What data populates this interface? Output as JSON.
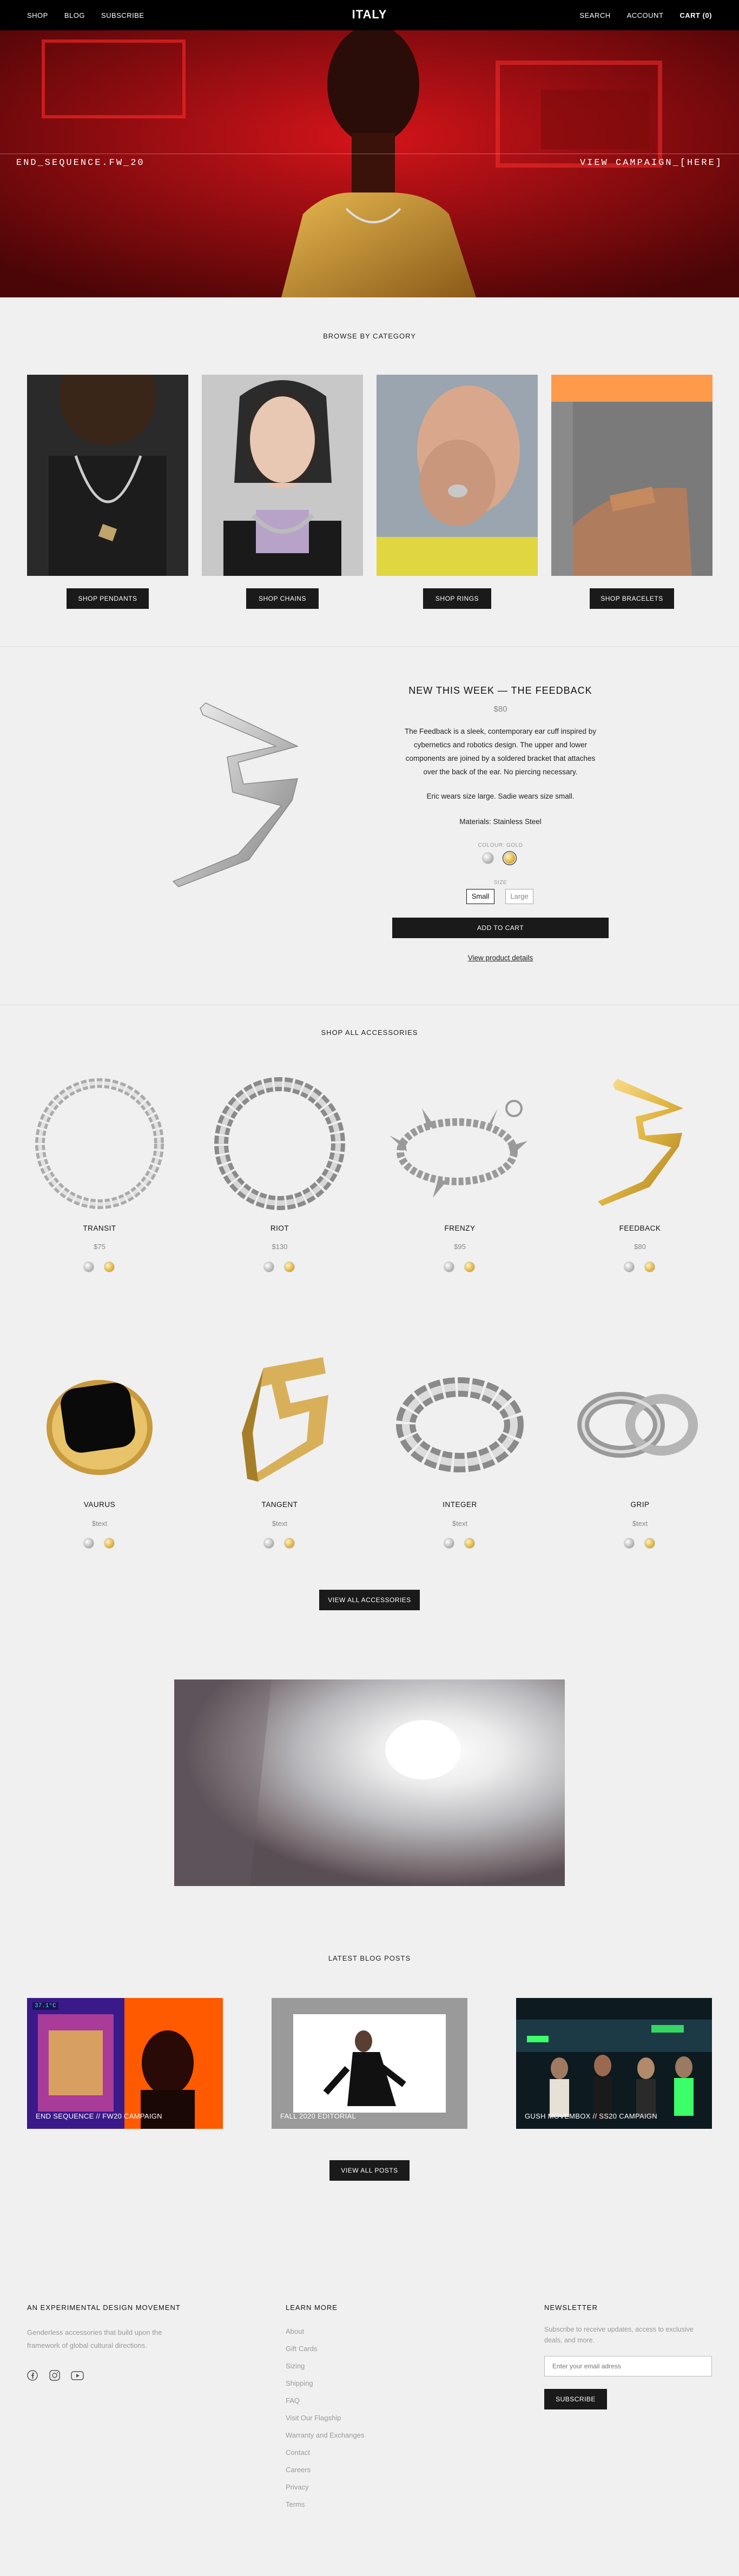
{
  "nav": {
    "left": [
      "SHOP",
      "BLOG",
      "SUBSCRIBE"
    ],
    "logo": "ITALY",
    "right": [
      "SEARCH",
      "ACCOUNT",
      "CART (0)"
    ]
  },
  "hero": {
    "left_text": "END_SEQUENCE.FW_20",
    "right_text": "VIEW CAMPAIGN_[HERE]"
  },
  "categories": {
    "title": "BROWSE BY CATEGORY",
    "items": [
      {
        "label": "SHOP PENDANTS"
      },
      {
        "label": "SHOP CHAINS"
      },
      {
        "label": "SHOP RINGS"
      },
      {
        "label": "SHOP BRACELETS"
      }
    ]
  },
  "featured": {
    "title": "NEW THIS WEEK — THE FEEDBACK",
    "price": "$80",
    "description": "The Feedback is a sleek, contemporary ear cuff inspired by cybernetics and robotics design. The upper and lower components are joined by a soldered bracket that attaches over the back of the ear. No piercing necessary.",
    "sizing_note": "Eric wears size large. Sadie wears size small.",
    "materials": "Materials: Stainless Steel",
    "colour_label": "COLOUR: GOLD",
    "size_label": "SIZE",
    "sizes": [
      "Small",
      "Large"
    ],
    "add_to_cart": "ADD TO CART",
    "details_link": "View product details"
  },
  "accessories": {
    "title": "SHOP ALL ACCESSORIES",
    "products": [
      {
        "name": "TRANSIT",
        "price": "$75"
      },
      {
        "name": "RIOT",
        "price": "$130"
      },
      {
        "name": "FRENZY",
        "price": "$95"
      },
      {
        "name": "FEEDBACK",
        "price": "$80"
      },
      {
        "name": "VAURUS",
        "price": "$text"
      },
      {
        "name": "TANGENT",
        "price": "$text"
      },
      {
        "name": "INTEGER",
        "price": "$text"
      },
      {
        "name": "GRIP",
        "price": "$text"
      }
    ],
    "view_all": "VIEW ALL ACCESSORIES"
  },
  "blog": {
    "title": "LATEST BLOG POSTS",
    "posts": [
      {
        "caption": "END SEQUENCE // FW20 CAMPAIGN",
        "temp": "37.1°C"
      },
      {
        "caption": "FALL 2020 EDITORIAL"
      },
      {
        "caption": "GUSH MOVEMBOX // SS20 CAMPAIGN"
      }
    ],
    "view_all": "VIEW ALL POSTS"
  },
  "footer": {
    "about_title": "AN EXPERIMENTAL DESIGN MOVEMENT",
    "about_text": "Genderless accessories that build upon the framework of global cultural directions.",
    "learn_title": "LEARN MORE",
    "links": [
      "About",
      "Gift Cards",
      "Sizing",
      "Shipping",
      "FAQ",
      "Visit Our Flagship",
      "Warranty and Exchanges",
      "Contact",
      "Careers",
      "Privacy",
      "Terms"
    ],
    "newsletter_title": "NEWSLETTER",
    "newsletter_text": "Subscribe to receive updates, access to exclusive deals, and more.",
    "email_placeholder": "Enter your email adress",
    "subscribe": "SUBSCRIBE"
  },
  "colors": {
    "dark": "#1a1a1a",
    "gold": "#e0b542",
    "silver": "#b8b8b8",
    "hero_red": "#c00a12"
  }
}
